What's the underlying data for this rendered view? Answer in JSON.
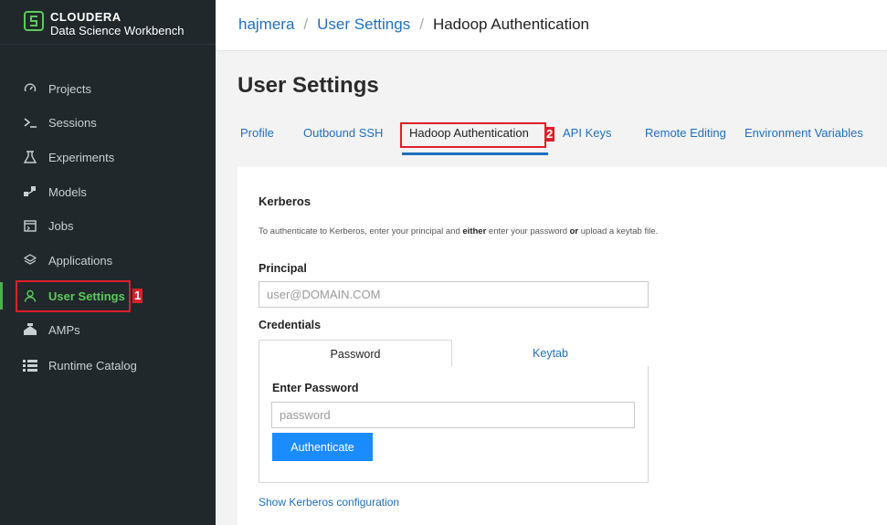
{
  "brand": {
    "line1": "CLOUDERA",
    "line2": "Data Science Workbench"
  },
  "sidebar": {
    "items": [
      {
        "label": "Projects",
        "icon": "gauge-icon"
      },
      {
        "label": "Sessions",
        "icon": "terminal-icon"
      },
      {
        "label": "Experiments",
        "icon": "flask-icon"
      },
      {
        "label": "Models",
        "icon": "models-icon"
      },
      {
        "label": "Jobs",
        "icon": "jobs-icon"
      },
      {
        "label": "Applications",
        "icon": "layers-icon"
      },
      {
        "label": "User Settings",
        "icon": "user-icon",
        "active": true
      },
      {
        "label": "AMPs",
        "icon": "amps-icon"
      },
      {
        "label": "Runtime Catalog",
        "icon": "list-icon"
      }
    ]
  },
  "annotations": {
    "first": "1",
    "second": "2"
  },
  "breadcrumb": {
    "user": "hajmera",
    "sep": "/",
    "settings": "User Settings",
    "current": "Hadoop Authentication"
  },
  "page": {
    "title": "User Settings"
  },
  "tabs": [
    "Profile",
    "Outbound SSH",
    "Hadoop Authentication",
    "API Keys",
    "Remote Editing",
    "Environment Variables"
  ],
  "kerberos": {
    "title": "Kerberos",
    "help_pre": "To authenticate to Kerberos, enter your principal and ",
    "help_either": "either",
    "help_mid": " enter your password ",
    "help_or": "or",
    "help_post": " upload a keytab file.",
    "principal_label": "Principal",
    "principal_placeholder": "user@DOMAIN.COM",
    "credentials_label": "Credentials",
    "tab_password": "Password",
    "tab_keytab": "Keytab",
    "enter_password_label": "Enter Password",
    "password_placeholder": "password",
    "authenticate_button": "Authenticate",
    "show_config_link": "Show Kerberos configuration"
  },
  "colors": {
    "accent": "#1f6fbf",
    "button": "#1a8cff",
    "active_nav": "#5cc95c",
    "annotation": "#e01e2b",
    "sidebar_bg": "#20282b"
  }
}
